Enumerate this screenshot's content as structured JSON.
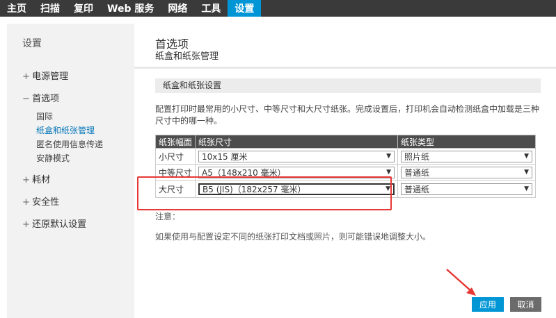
{
  "topnav": {
    "tabs": [
      {
        "label": "主页"
      },
      {
        "label": "扫描"
      },
      {
        "label": "复印"
      },
      {
        "label": "Web 服务"
      },
      {
        "label": "网络"
      },
      {
        "label": "工具"
      },
      {
        "label": "设置"
      }
    ],
    "active_index": 6,
    "active_color": "#0096d6"
  },
  "sidebar": {
    "title": "设置",
    "items": [
      {
        "sign": "+",
        "label": "电源管理"
      },
      {
        "sign": "−",
        "label": "首选项"
      },
      {
        "sign": "+",
        "label": "耗材"
      },
      {
        "sign": "+",
        "label": "安全性"
      },
      {
        "sign": "+",
        "label": "还原默认设置"
      }
    ],
    "subitems": [
      {
        "label": "国际"
      },
      {
        "label": "纸盒和纸张管理"
      },
      {
        "label": "匿名使用信息传递"
      },
      {
        "label": "安静模式"
      }
    ]
  },
  "main": {
    "title": "首选项",
    "subtitle": "纸盒和纸张管理",
    "section_header": "纸盒和纸张设置",
    "description": "配置打印时最常用的小尺寸、中等尺寸和大尺寸纸张。完成设置后，打印机会自动检测纸盒中加载是三种尺寸中的哪一种。",
    "table": {
      "headers": [
        "纸张幅面",
        "纸张尺寸",
        "纸张类型"
      ],
      "rows": [
        {
          "format": "小尺寸",
          "size": "10x15 厘米",
          "type": "照片纸"
        },
        {
          "format": "中等尺寸",
          "size": "A5（148x210 毫米）",
          "type": "普通纸"
        },
        {
          "format": "大尺寸",
          "size": "B5 (JIS)（182x257 毫米）",
          "type": "普通纸"
        }
      ]
    },
    "note_label": "注意：",
    "note_text": "如果使用与配置设定不同的纸张打印文档或照片，则可能错误地调整大小。",
    "apply_label": "应用",
    "cancel_label": "取消"
  },
  "colors": {
    "accent": "#0096d6",
    "annotation": "#e53935"
  }
}
